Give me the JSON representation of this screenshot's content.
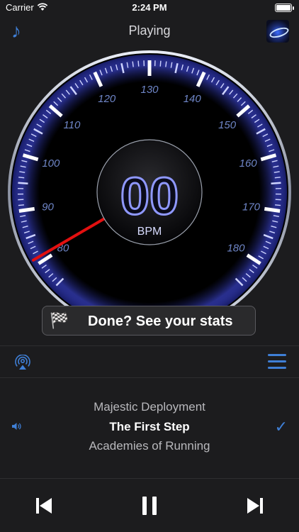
{
  "status_bar": {
    "carrier": "Carrier",
    "time": "2:24 PM"
  },
  "nav": {
    "title": "Playing",
    "music_icon": "music-note-icon",
    "art_icon": "album-art-icon"
  },
  "gauge": {
    "bpm": "00",
    "unit": "BPM",
    "min": 75,
    "max": 185,
    "needle_value": 81,
    "tick_labels": [
      "80",
      "90",
      "100",
      "110",
      "120",
      "130",
      "140",
      "150",
      "160",
      "170",
      "180"
    ],
    "accent_color": "#5b6bff"
  },
  "toast": {
    "icon": "checkered-flags-icon",
    "label": "Done? See your stats"
  },
  "toolbar": {
    "airplay_icon": "airplay-icon",
    "menu_icon": "menu-icon"
  },
  "tracks": {
    "previous": "Majestic Deployment",
    "current": "The First Step",
    "next": "Academies of Running"
  },
  "controls": {
    "prev_icon": "skip-back-icon",
    "pause_icon": "pause-icon",
    "next_icon": "skip-forward-icon"
  },
  "colors": {
    "background": "#1c1c1e",
    "accent": "#3f7fd6",
    "needle": "#e21010"
  }
}
